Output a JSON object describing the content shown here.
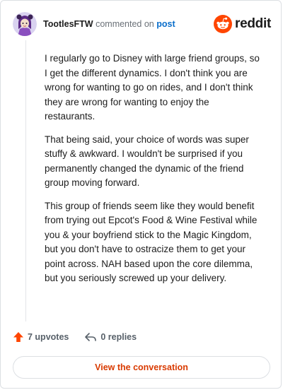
{
  "header": {
    "author": "TootlesFTW",
    "action_text": "commented on",
    "post_link": "post",
    "brand": "reddit",
    "avatar_icon": "character-avatar-icon",
    "brand_icon": "reddit-snoo-icon"
  },
  "comment": {
    "paragraphs": [
      "I regularly go to Disney with large friend groups, so I get the different dynamics. I don't think you are wrong for wanting to go on rides, and I don't think they are wrong for wanting to enjoy the restaurants.",
      "That being said, your choice of words was super stuffy & awkward. I wouldn't be surprised if you permanently changed the dynamic of the friend group moving forward.",
      "This group of friends seem like they would benefit from trying out Epcot's Food & Wine Festival while you & your boyfriend stick to the Magic Kingdom, but you don't have to ostracize them to get your point across. NAH based upon the core dilemma, but you seriously screwed up your delivery."
    ]
  },
  "footer": {
    "upvotes": "7 upvotes",
    "replies": "0 replies",
    "upvote_icon": "upvote-arrow-icon",
    "reply_icon": "reply-arrow-icon",
    "view_button": "View the conversation"
  },
  "colors": {
    "upvote": "#ff4500",
    "brand": "#ff4500",
    "link": "#0a6ecb",
    "button_text": "#d93a00"
  }
}
